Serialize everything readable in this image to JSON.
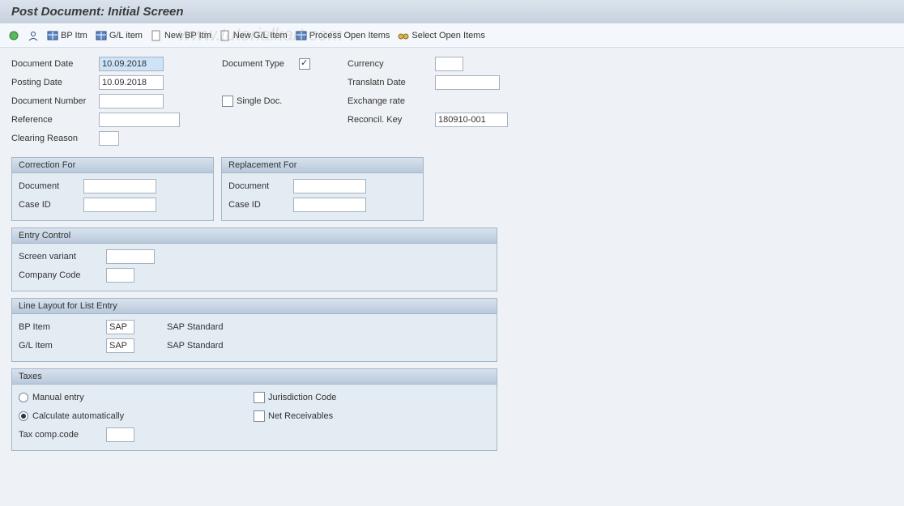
{
  "title": "Post Document: Initial Screen",
  "watermark": "www.tutorialkart.com",
  "toolbar": [
    {
      "name": "exec-icon",
      "label": ""
    },
    {
      "name": "user-icon",
      "label": ""
    },
    {
      "name": "bp-itm",
      "label": "BP Itm"
    },
    {
      "name": "gl-item",
      "label": "G/L item"
    },
    {
      "name": "new-bp-itm",
      "label": "New BP Itm"
    },
    {
      "name": "new-gl-item",
      "label": "New G/L Item"
    },
    {
      "name": "process-open-items",
      "label": "Process Open Items"
    },
    {
      "name": "select-open-items",
      "label": "Select Open Items"
    }
  ],
  "header": {
    "doc_date_lbl": "Document Date",
    "doc_date": "10.09.2018",
    "posting_date_lbl": "Posting Date",
    "posting_date": "10.09.2018",
    "doc_number_lbl": "Document Number",
    "doc_number": "",
    "reference_lbl": "Reference",
    "reference": "",
    "clearing_reason_lbl": "Clearing Reason",
    "clearing_reason": "",
    "doc_type_lbl": "Document Type",
    "doc_type_chk": true,
    "single_doc_lbl": "Single Doc.",
    "currency_lbl": "Currency",
    "currency": "",
    "transl_date_lbl": "Translatn Date",
    "transl_date": "",
    "exch_rate_lbl": "Exchange rate",
    "exch_rate": "",
    "reconcil_lbl": "Reconcil. Key",
    "reconcil": "180910-001"
  },
  "correction": {
    "title": "Correction For",
    "doc_lbl": "Document",
    "doc": "",
    "case_lbl": "Case ID",
    "case": ""
  },
  "replacement": {
    "title": "Replacement For",
    "doc_lbl": "Document",
    "doc": "",
    "case_lbl": "Case ID",
    "case": ""
  },
  "entry": {
    "title": "Entry Control",
    "variant_lbl": "Screen variant",
    "variant": "",
    "company_lbl": "Company Code",
    "company": ""
  },
  "layout": {
    "title": "Line Layout for List Entry",
    "bp_lbl": "BP Item",
    "bp_val": "SAP",
    "bp_desc": "SAP Standard",
    "gl_lbl": "G/L Item",
    "gl_val": "SAP",
    "gl_desc": "SAP Standard"
  },
  "taxes": {
    "title": "Taxes",
    "manual_lbl": "Manual entry",
    "calc_lbl": "Calculate automatically",
    "comp_lbl": "Tax comp.code",
    "comp": "",
    "jur_lbl": "Jurisdiction Code",
    "net_lbl": "Net Receivables"
  }
}
